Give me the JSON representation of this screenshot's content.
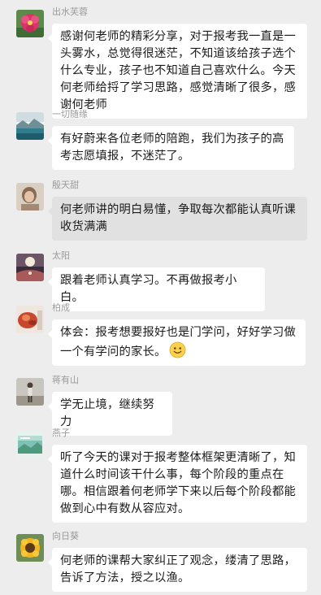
{
  "messages": [
    {
      "sender": "出水芙蓉",
      "avatar_icon": "pink-flower-avatar",
      "text": "感谢何老师的精彩分享，对于报考我一直是一头雾水，总觉得很迷茫，不知道该给孩子选个什么专业，孩子也不知道自己喜欢什么。今天何老师给捋了学习思路，感觉清晰了很多，感谢何老师"
    },
    {
      "sender": "一切随缘",
      "avatar_icon": "lake-landscape-avatar",
      "text": "有好蔚来各位老师的陪跑，我们为孩子的高考志愿填报，不迷茫了。"
    },
    {
      "sender": "殷天甜",
      "avatar_icon": "portrait-avatar",
      "text": "何老师讲的明白易懂，争取每次都能认真听课收货满满"
    },
    {
      "sender": "太阳",
      "avatar_icon": "moon-night-avatar",
      "text": "跟着老师认真学习。不再做报考小白。"
    },
    {
      "sender": "柏成",
      "avatar_icon": "food-plate-avatar",
      "text": "体会：报考想要报好也是门学问，好好学习做一个有学问的家长。",
      "emoji": "smile-emoji"
    },
    {
      "sender": "蒋有山",
      "avatar_icon": "figure-outdoor-avatar",
      "text": "学无止境，继续努力"
    },
    {
      "sender": "燕子",
      "avatar_icon": "scenery-card-avatar",
      "text": "听了今天的课对于报考整体框架更清晰了，知道什么时间该干什么事，每个阶段的重点在哪。相信跟着何老师学下来以后每个阶段都能做到心中有数从容应对。"
    },
    {
      "sender": "向日葵",
      "avatar_icon": "sunflower-avatar",
      "text": "何老师的课帮大家纠正了观念，缕清了思路，告诉了方法，授之以渔。"
    }
  ]
}
